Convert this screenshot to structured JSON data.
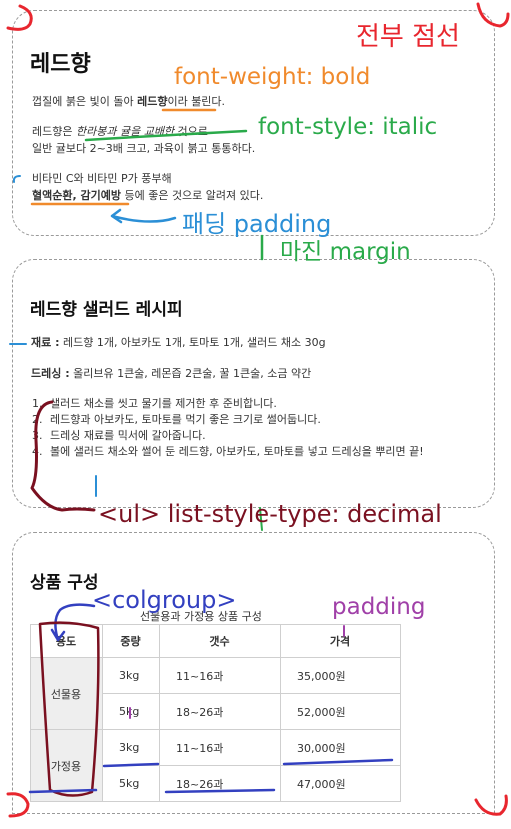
{
  "annotations": {
    "dashed_all": "전부 점선",
    "font_weight": "font-weight: bold",
    "font_style": "font-style: italic",
    "padding1": "패딩 padding",
    "margin": "마진 margin",
    "ul_label": "<ul> list-style-type: decimal",
    "colgroup": "<colgroup>",
    "padding2": "padding"
  },
  "section1": {
    "title": "레드향",
    "line1a": "껍질에 붉은 빛이 돌아 ",
    "line1b": "레드향",
    "line1c": "이라 불린다.",
    "line2a": "레드향은 ",
    "line2b": "한라봉과 귤을 교배한",
    "line2c": " 것으로",
    "line3": "일반 귤보다 2~3배 크고, 과육이 붉고 통통하다.",
    "line4": "비타민 C와 비타민 P가 풍부해",
    "line5a": "혈액순환, 감기예방",
    "line5b": " 등에 좋은 것으로 알려져 있다."
  },
  "section2": {
    "title": "레드향 샐러드 레시피",
    "ingredients_label": "재료 :",
    "ingredients": " 레드향 1개, 아보카도 1개, 토마토 1개, 샐러드 채소 30g",
    "dressing_label": "드레싱 :",
    "dressing": " 올리브유 1큰술, 레몬즙 2큰술, 꿀 1큰술, 소금 약간",
    "steps": [
      "샐러드 채소를 씻고 물기를 제거한 후 준비합니다.",
      "레드향과 아보카도, 토마토를 먹기 좋은 크기로 썰어둡니다.",
      "드레싱 재료를 믹서에 갈아줍니다.",
      "볼에 샐러드 채소와 썰어 둔 레드향, 아보카도, 토마토를 넣고 드레싱을 뿌리면 끝!"
    ]
  },
  "section3": {
    "title": "상품 구성",
    "caption": "선물용과 가정용 상품 구성",
    "headers": [
      "용도",
      "중량",
      "갯수",
      "가격"
    ],
    "group1": "선물용",
    "group2": "가정용",
    "rows": [
      [
        "3kg",
        "11~16과",
        "35,000원"
      ],
      [
        "5kg",
        "18~26과",
        "52,000원"
      ],
      [
        "3kg",
        "11~16과",
        "30,000원"
      ],
      [
        "5kg",
        "18~26과",
        "47,000원"
      ]
    ]
  },
  "colors": {
    "red": "#e8262e",
    "orange": "#f08a2c",
    "green": "#2aaa4a",
    "blue": "#2b8fd6",
    "darkred": "#7a1020",
    "navy": "#3340c0",
    "purple": "#a040a8"
  }
}
